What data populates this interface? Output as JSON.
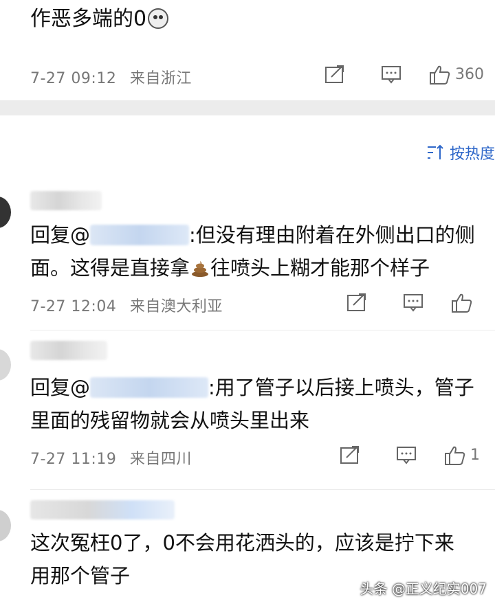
{
  "top_comment": {
    "text": "作恶多端的0",
    "emoji": "husky-face-emoji",
    "timestamp": "7-27 09:12",
    "location": "来自浙江",
    "like_count": "360"
  },
  "sort": {
    "label": "按热度",
    "icon": "sort-icon"
  },
  "replies": [
    {
      "reply_prefix": "回复@",
      "text_after_mention": ":但没有理由附着在外侧出口的侧",
      "line2_before_emoji": "面。这得是直接拿",
      "emoji": "poop-emoji",
      "line2_after_emoji": "往喷头上糊才能那个样子",
      "timestamp": "7-27 12:04",
      "location": "来自澳大利亚"
    },
    {
      "reply_prefix": "回复@",
      "text_after_mention": ":用了管子以后接上喷头，管子",
      "line2": "里面的残留物就会从喷头里出来",
      "timestamp": "7-27 11:19",
      "location": "来自四川",
      "like_count": "1"
    },
    {
      "line1": "这次冤枉0了，0不会用花洒头的，应该是拧下来",
      "line2": "用那个管子"
    }
  ],
  "watermark": "头条 @正义纪实007",
  "colors": {
    "accent": "#2e67c9",
    "meta_text": "#777777",
    "divider": "#ececec"
  }
}
